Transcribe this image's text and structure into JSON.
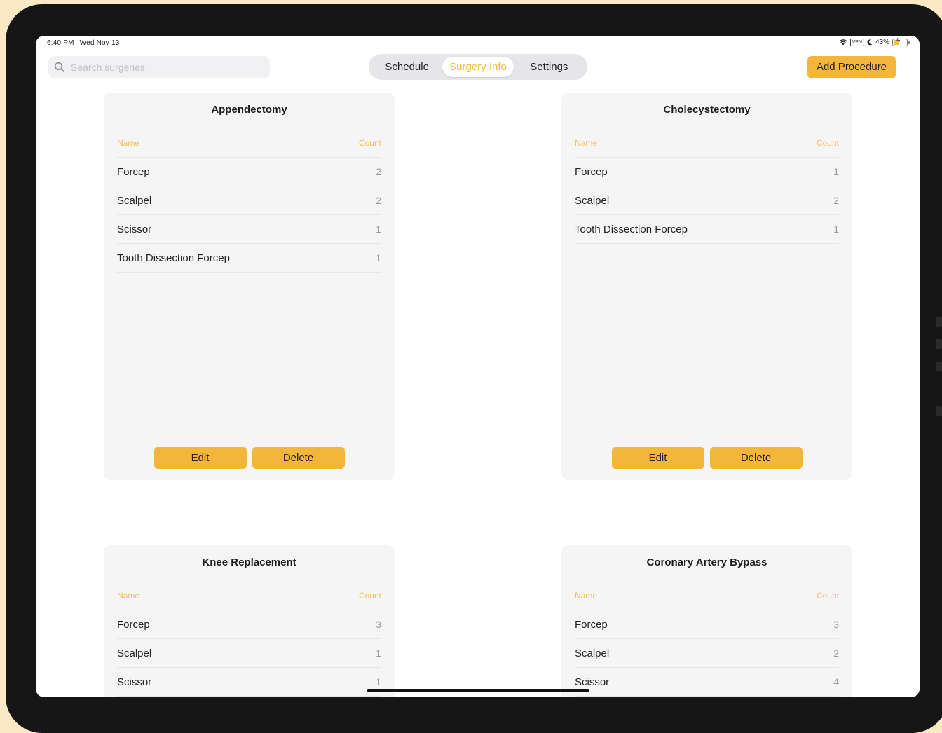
{
  "status": {
    "time": "6:40 PM",
    "date": "Wed Nov 13",
    "vpn": "VPN",
    "battery": "43%"
  },
  "search": {
    "placeholder": "Search surgeries",
    "value": ""
  },
  "tabs": [
    {
      "label": "Schedule",
      "active": false
    },
    {
      "label": "Surgery Info",
      "active": true
    },
    {
      "label": "Settings",
      "active": false
    }
  ],
  "add_button": "Add Procedure",
  "table_headers": {
    "name": "Name",
    "count": "Count"
  },
  "actions": {
    "edit": "Edit",
    "delete": "Delete"
  },
  "procedures": [
    {
      "title": "Appendectomy",
      "items": [
        {
          "name": "Forcep",
          "count": "2"
        },
        {
          "name": "Scalpel",
          "count": "2"
        },
        {
          "name": "Scissor",
          "count": "1"
        },
        {
          "name": "Tooth Dissection Forcep",
          "count": "1"
        }
      ]
    },
    {
      "title": "Cholecystectomy",
      "items": [
        {
          "name": "Forcep",
          "count": "1"
        },
        {
          "name": "Scalpel",
          "count": "2"
        },
        {
          "name": "Tooth Dissection Forcep",
          "count": "1"
        }
      ]
    },
    {
      "title": "Knee Replacement",
      "items": [
        {
          "name": "Forcep",
          "count": "3"
        },
        {
          "name": "Scalpel",
          "count": "1"
        },
        {
          "name": "Scissor",
          "count": "1"
        }
      ]
    },
    {
      "title": "Coronary Artery Bypass",
      "items": [
        {
          "name": "Forcep",
          "count": "3"
        },
        {
          "name": "Scalpel",
          "count": "2"
        },
        {
          "name": "Scissor",
          "count": "4"
        }
      ]
    }
  ],
  "colors": {
    "accent": "#f3b63b",
    "accent_text": "#f5b93d",
    "background": "#fbe9c6"
  }
}
